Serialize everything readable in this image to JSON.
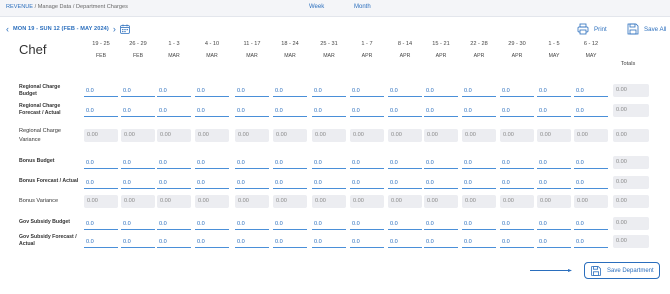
{
  "breadcrumb": {
    "root": "REVENUE",
    "trail": " / Manage Data / Department Charges"
  },
  "view_tabs": [
    {
      "label": "Week"
    },
    {
      "label": "Month"
    }
  ],
  "date_range": "MON 19 - SUN 12 (FEB - MAY 2024)",
  "toolbar": {
    "print_label": "Print",
    "save_all_label": "Save All"
  },
  "grid": {
    "title": "Chef",
    "totals_label": "Totals",
    "columns": [
      {
        "range": "19 - 25",
        "month": "FEB"
      },
      {
        "range": "26 - 29",
        "month": "FEB"
      },
      {
        "range": "1 - 3",
        "month": "MAR"
      },
      {
        "range": "4 - 10",
        "month": "MAR"
      },
      {
        "range": "11 - 17",
        "month": "MAR"
      },
      {
        "range": "18 - 24",
        "month": "MAR"
      },
      {
        "range": "25 - 31",
        "month": "MAR"
      },
      {
        "range": "1 - 7",
        "month": "APR"
      },
      {
        "range": "8 - 14",
        "month": "APR"
      },
      {
        "range": "15 - 21",
        "month": "APR"
      },
      {
        "range": "22 - 28",
        "month": "APR"
      },
      {
        "range": "29 - 30",
        "month": "APR"
      },
      {
        "range": "1 - 5",
        "month": "MAY"
      },
      {
        "range": "6 - 12",
        "month": "MAY"
      }
    ],
    "rows": [
      {
        "label": "Regional Charge Budget",
        "editable": true,
        "values": [
          "0.0",
          "0.0",
          "0.0",
          "0.0",
          "0.0",
          "0.0",
          "0.0",
          "0.0",
          "0.0",
          "0.0",
          "0.0",
          "0.0",
          "0.0",
          "0.0"
        ],
        "total": "0.00"
      },
      {
        "label": "Regional Charge Forecast / Actual",
        "editable": true,
        "values": [
          "0.0",
          "0.0",
          "0.0",
          "0.0",
          "0.0",
          "0.0",
          "0.0",
          "0.0",
          "0.0",
          "0.0",
          "0.0",
          "0.0",
          "0.0",
          "0.0"
        ],
        "total": "0.00"
      },
      {
        "label": "Regional Charge Variance",
        "editable": false,
        "values": [
          "0.00",
          "0.00",
          "0.00",
          "0.00",
          "0.00",
          "0.00",
          "0.00",
          "0.00",
          "0.00",
          "0.00",
          "0.00",
          "0.00",
          "0.00",
          "0.00"
        ],
        "total": "0.00"
      },
      {
        "label": "Bonus Budget",
        "editable": true,
        "values": [
          "0.0",
          "0.0",
          "0.0",
          "0.0",
          "0.0",
          "0.0",
          "0.0",
          "0.0",
          "0.0",
          "0.0",
          "0.0",
          "0.0",
          "0.0",
          "0.0"
        ],
        "total": "0.00"
      },
      {
        "label": "Bonus Forecast / Actual",
        "editable": true,
        "values": [
          "0.0",
          "0.0",
          "0.0",
          "0.0",
          "0.0",
          "0.0",
          "0.0",
          "0.0",
          "0.0",
          "0.0",
          "0.0",
          "0.0",
          "0.0",
          "0.0"
        ],
        "total": "0.00"
      },
      {
        "label": "Bonus Variance",
        "editable": false,
        "values": [
          "0.00",
          "0.00",
          "0.00",
          "0.00",
          "0.00",
          "0.00",
          "0.00",
          "0.00",
          "0.00",
          "0.00",
          "0.00",
          "0.00",
          "0.00",
          "0.00"
        ],
        "total": "0.00"
      },
      {
        "label": "Gov Subsidy Budget",
        "editable": true,
        "values": [
          "0.0",
          "0.0",
          "0.0",
          "0.0",
          "0.0",
          "0.0",
          "0.0",
          "0.0",
          "0.0",
          "0.0",
          "0.0",
          "0.0",
          "0.0",
          "0.0"
        ],
        "total": "0.00"
      },
      {
        "label": "Gov Subsidy Forecast / Actual",
        "editable": true,
        "values": [
          "0.0",
          "0.0",
          "0.0",
          "0.0",
          "0.0",
          "0.0",
          "0.0",
          "0.0",
          "0.0",
          "0.0",
          "0.0",
          "0.0",
          "0.0",
          "0.0"
        ],
        "total": "0.00"
      }
    ]
  },
  "save_department_label": "Save Department",
  "colors": {
    "accent": "#2a6ebd",
    "readonly_bg": "#ecedf1",
    "page_bg": "#f4f5f8"
  }
}
